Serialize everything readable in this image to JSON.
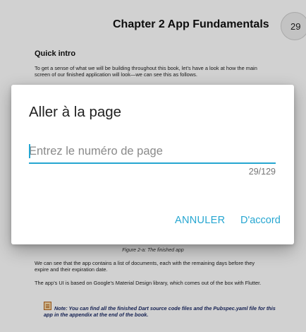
{
  "book": {
    "chapter_title": "Chapter 2  App Fundamentals",
    "page_number": "29",
    "section_heading": "Quick intro",
    "intro_paragraph": "To get a sense of what we will be building throughout this book, let’s have a look at how the main screen of our finished application will look—we can see this as follows.",
    "figure_caption": "Figure 2-a: The finished app",
    "paragraph_2": "We can see that the app contains a list of documents, each with the remaining days before they expire and their expiration date.",
    "paragraph_3": "The app’s UI is based on Google’s Material Design library, which comes out of the box with Flutter.",
    "note": "Note: You can find all the finished Dart source code files and the Pubspec.yaml file for this app in the appendix at the end of the book.",
    "note_icon": "note-icon"
  },
  "dialog": {
    "title": "Aller à la page",
    "input_placeholder": "Entrez le numéro de page",
    "input_value": "",
    "counter": "29/129",
    "cancel_label": "ANNULER",
    "ok_label": "D'accord",
    "accent_color": "#26a6d1"
  }
}
